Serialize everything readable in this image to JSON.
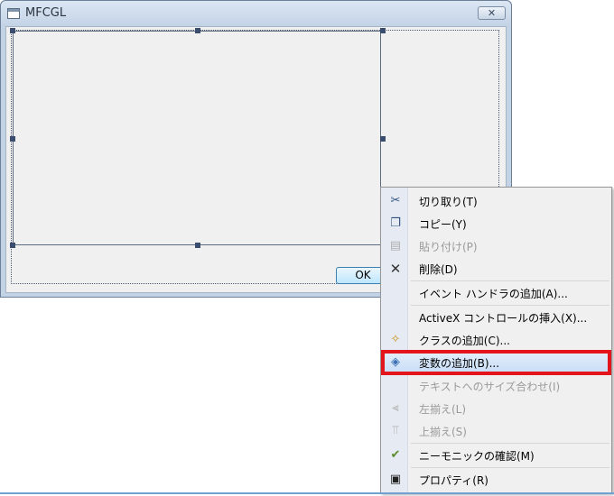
{
  "window": {
    "title": "MFCGL",
    "close_glyph": "✕"
  },
  "dialog": {
    "ok_label": "OK"
  },
  "context_menu": {
    "items": [
      {
        "label": "切り取り(T)",
        "icon": "scissors-icon",
        "glyph": "✂",
        "enabled": true
      },
      {
        "label": "コピー(Y)",
        "icon": "copy-icon",
        "glyph": "❐",
        "enabled": true
      },
      {
        "label": "貼り付け(P)",
        "icon": "paste-icon",
        "glyph": "▤",
        "enabled": false
      },
      {
        "label": "削除(D)",
        "icon": "delete-icon",
        "glyph": "✕",
        "enabled": true
      },
      {
        "label": "イベント ハンドラの追加(A)...",
        "icon": "",
        "glyph": "",
        "enabled": true
      },
      {
        "label": "ActiveX コントロールの挿入(X)...",
        "icon": "",
        "glyph": "",
        "enabled": true
      },
      {
        "label": "クラスの追加(C)...",
        "icon": "add-class-icon",
        "glyph": "✧",
        "enabled": true
      },
      {
        "label": "変数の追加(B)...",
        "icon": "add-variable-icon",
        "glyph": "◈",
        "enabled": true
      },
      {
        "label": "テキストへのサイズ合わせ(I)",
        "icon": "",
        "glyph": "",
        "enabled": false
      },
      {
        "label": "左揃え(L)",
        "icon": "align-left-icon",
        "glyph": "⫷",
        "enabled": false
      },
      {
        "label": "上揃え(S)",
        "icon": "align-top-icon",
        "glyph": "⫪",
        "enabled": false
      },
      {
        "label": "ニーモニックの確認(M)",
        "icon": "check-mnemonics-icon",
        "glyph": "✔",
        "enabled": true
      },
      {
        "label": "プロパティ(R)",
        "icon": "properties-icon",
        "glyph": "▣",
        "enabled": true
      }
    ]
  },
  "colors": {
    "highlight": "#e3141b",
    "hover_bg": "#c9ddf6"
  }
}
